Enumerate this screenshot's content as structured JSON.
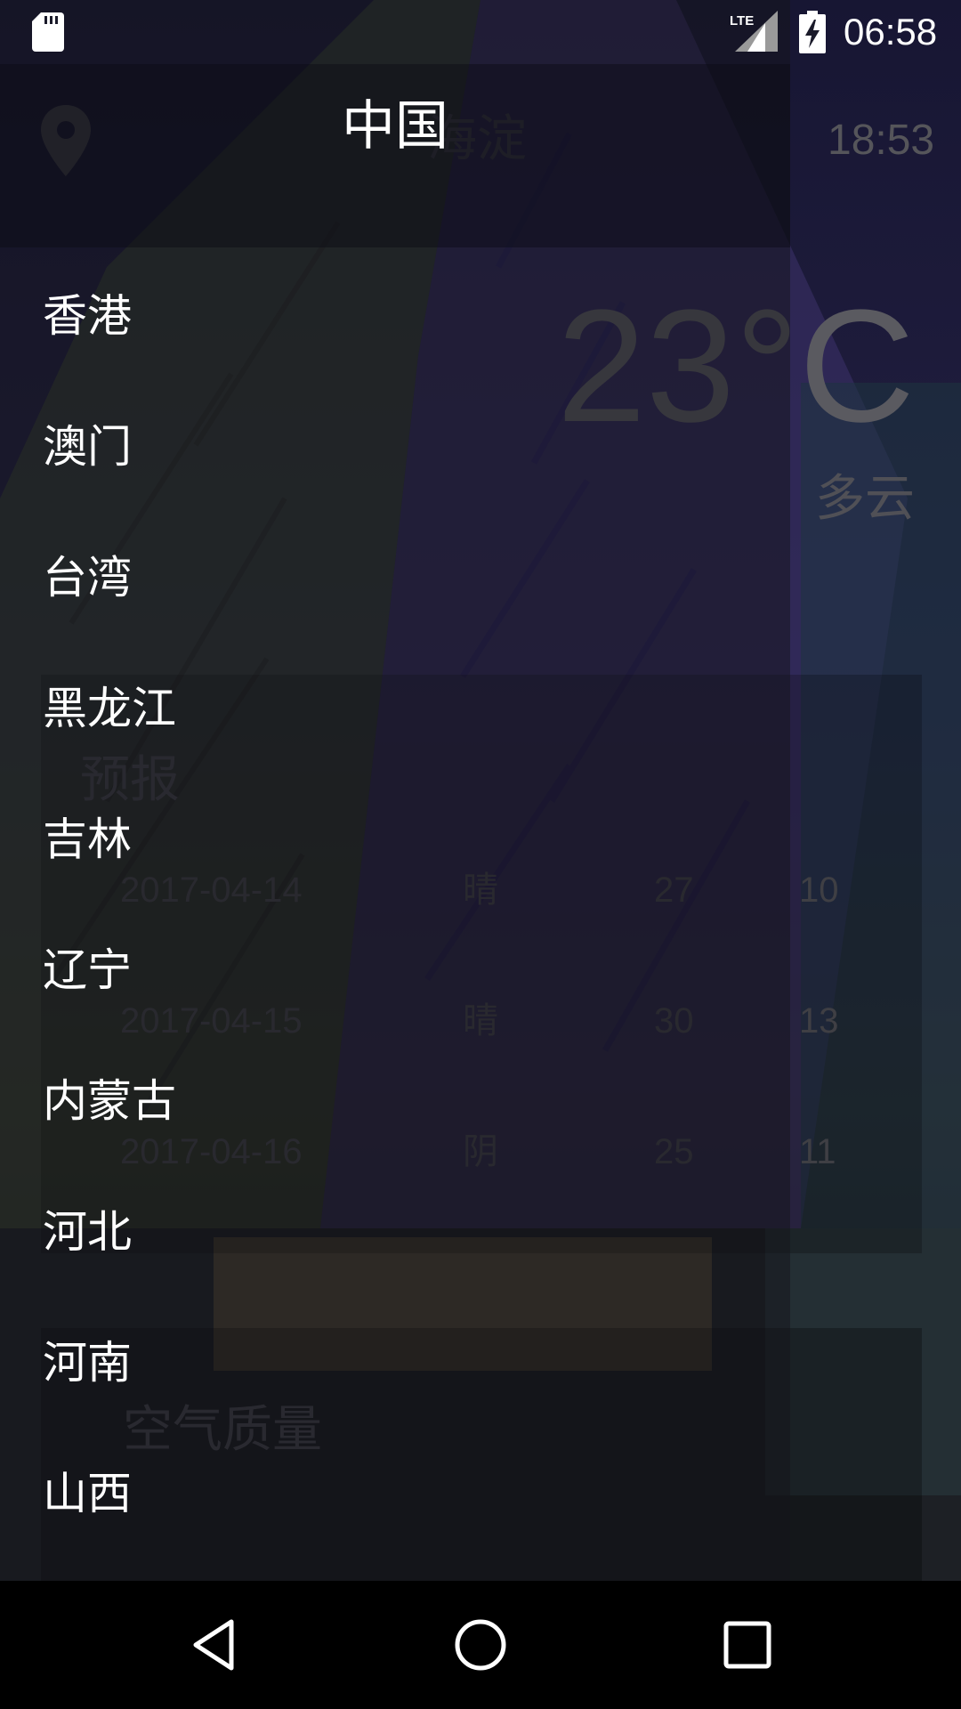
{
  "status_bar": {
    "time": "06:58",
    "network": "LTE",
    "icons": [
      "sd-card-icon",
      "lte-signal-icon",
      "battery-charging-icon"
    ]
  },
  "weather": {
    "city": "海淀",
    "update_time": "18:53",
    "temperature": "23°C",
    "condition": "多云",
    "forecast_title": "预报",
    "forecast": [
      {
        "date": "2017-04-14",
        "condition": "晴",
        "high": "27",
        "low": "10"
      },
      {
        "date": "2017-04-15",
        "condition": "晴",
        "high": "30",
        "low": "13"
      },
      {
        "date": "2017-04-16",
        "condition": "阴",
        "high": "25",
        "low": "11"
      }
    ],
    "aqi_title": "空气质量"
  },
  "drawer": {
    "title": "中国",
    "items": [
      "香港",
      "澳门",
      "台湾",
      "黑龙江",
      "吉林",
      "辽宁",
      "内蒙古",
      "河北",
      "河南",
      "山西"
    ]
  },
  "nav_bar": {
    "icons": [
      "back-icon",
      "home-icon",
      "recents-icon"
    ]
  }
}
